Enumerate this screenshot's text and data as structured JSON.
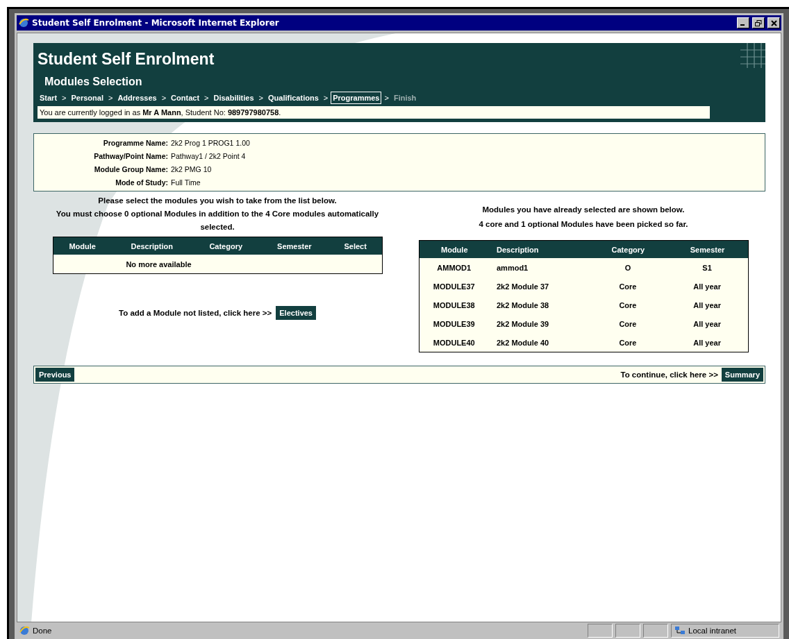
{
  "window": {
    "title": "Student Self Enrolment - Microsoft Internet Explorer"
  },
  "header": {
    "title": "Student Self Enrolment",
    "subtitle": "Modules Selection",
    "breadcrumbs": [
      {
        "label": "Start",
        "selected": false,
        "disabled": false
      },
      {
        "label": "Personal",
        "selected": false,
        "disabled": false
      },
      {
        "label": "Addresses",
        "selected": false,
        "disabled": false
      },
      {
        "label": "Contact",
        "selected": false,
        "disabled": false
      },
      {
        "label": "Disabilities",
        "selected": false,
        "disabled": false
      },
      {
        "label": "Qualifications",
        "selected": false,
        "disabled": false
      },
      {
        "label": "Programmes",
        "selected": true,
        "disabled": false
      },
      {
        "label": "Finish",
        "selected": false,
        "disabled": true
      }
    ],
    "separator": ">",
    "login_text": "You are currently logged in as **Mr A Mann**, Student No: **989797980758**."
  },
  "details": [
    {
      "label": "Programme Name:",
      "value": "2k2 Prog 1 PROG1 1.00"
    },
    {
      "label": "Pathway/Point Name:",
      "value": "Pathway1 / 2k2 Point 4"
    },
    {
      "label": "Module Group Name:",
      "value": "2k2 PMG 10"
    },
    {
      "label": "Mode of Study:",
      "value": "Full Time"
    }
  ],
  "available": {
    "intro": [
      "Please select the modules you wish to take from the list below.",
      "You must choose 0 optional Modules in addition to the 4 Core modules automatically selected."
    ],
    "columns": [
      "Module",
      "Description",
      "Category",
      "Semester",
      "Select"
    ],
    "empty_text": "No more available",
    "add_text": "To add a Module not listed, click here >>",
    "add_button": "Electives"
  },
  "selected": {
    "intro": [
      "Modules you have already selected are shown below.",
      "4 core and 1 optional Modules have been picked so far."
    ],
    "columns": [
      "Module",
      "Description",
      "Category",
      "Semester"
    ],
    "rows": [
      [
        "AMMOD1",
        "ammod1",
        "O",
        "S1"
      ],
      [
        "MODULE37",
        "2k2 Module 37",
        "Core",
        "All year"
      ],
      [
        "MODULE38",
        "2k2 Module 38",
        "Core",
        "All year"
      ],
      [
        "MODULE39",
        "2k2 Module 39",
        "Core",
        "All year"
      ],
      [
        "MODULE40",
        "2k2 Module 40",
        "Core",
        "All year"
      ]
    ]
  },
  "nav": {
    "previous": "Previous",
    "continue_text": "To continue, click here >>",
    "summary": "Summary"
  },
  "status_bar": {
    "text": "Done",
    "zone": "Local intranet"
  }
}
